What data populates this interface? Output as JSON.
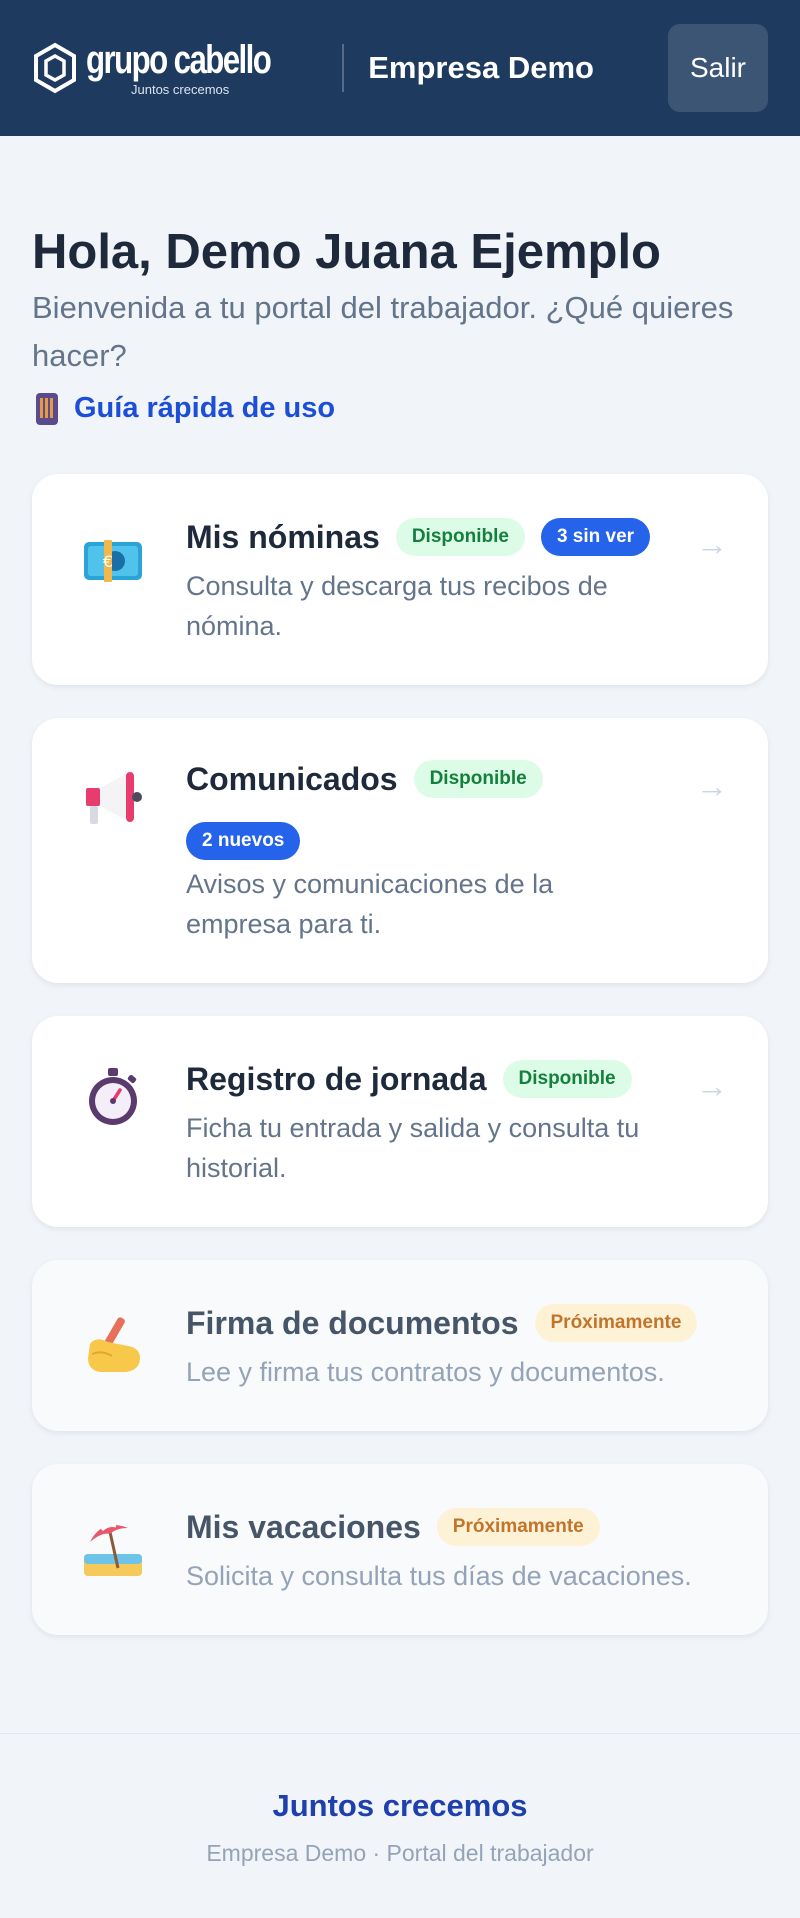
{
  "header": {
    "logo_name": "grupo cabello",
    "logo_tagline": "Juntos crecemos",
    "company": "Empresa Demo",
    "logout_label": "Salir"
  },
  "greeting": {
    "title": "Hola, Demo Juana Ejemplo",
    "subtitle": "Bienvenida a tu portal del trabajador. ¿Qué quieres hacer?",
    "guide_label": "Guía rápida de uso",
    "guide_icon": "mobile-phone-icon"
  },
  "cards": [
    {
      "icon": "money-icon",
      "title": "Mis nóminas",
      "status": "Disponible",
      "badge": "3 sin ver",
      "description": "Consulta y descarga tus recibos de nómina.",
      "arrow": "→"
    },
    {
      "icon": "megaphone-icon",
      "title": "Comunicados",
      "status": "Disponible",
      "badge": "2 nuevos",
      "description": "Avisos y comunicaciones de la empresa para ti.",
      "arrow": "→"
    },
    {
      "icon": "stopwatch-icon",
      "title": "Registro de jornada",
      "status": "Disponible",
      "description": "Ficha tu entrada y salida y consulta tu historial.",
      "arrow": "→"
    },
    {
      "icon": "writing-hand-icon",
      "title": "Firma de documentos",
      "status": "Próximamente",
      "description": "Lee y firma tus contratos y documentos."
    },
    {
      "icon": "beach-umbrella-icon",
      "title": "Mis vacaciones",
      "status": "Próximamente",
      "description": "Solicita y consulta tus días de vacaciones."
    }
  ],
  "footer": {
    "title": "Juntos crecemos",
    "subtitle": "Empresa Demo · Portal del trabajador"
  },
  "colors": {
    "header_bg": "#1e3a5f",
    "page_bg": "#f1f5f9",
    "accent": "#2563eb",
    "available_bg": "#dcfce7",
    "available_text": "#15803d",
    "soon_bg": "#fdf1d6",
    "soon_text": "#c2752a"
  }
}
